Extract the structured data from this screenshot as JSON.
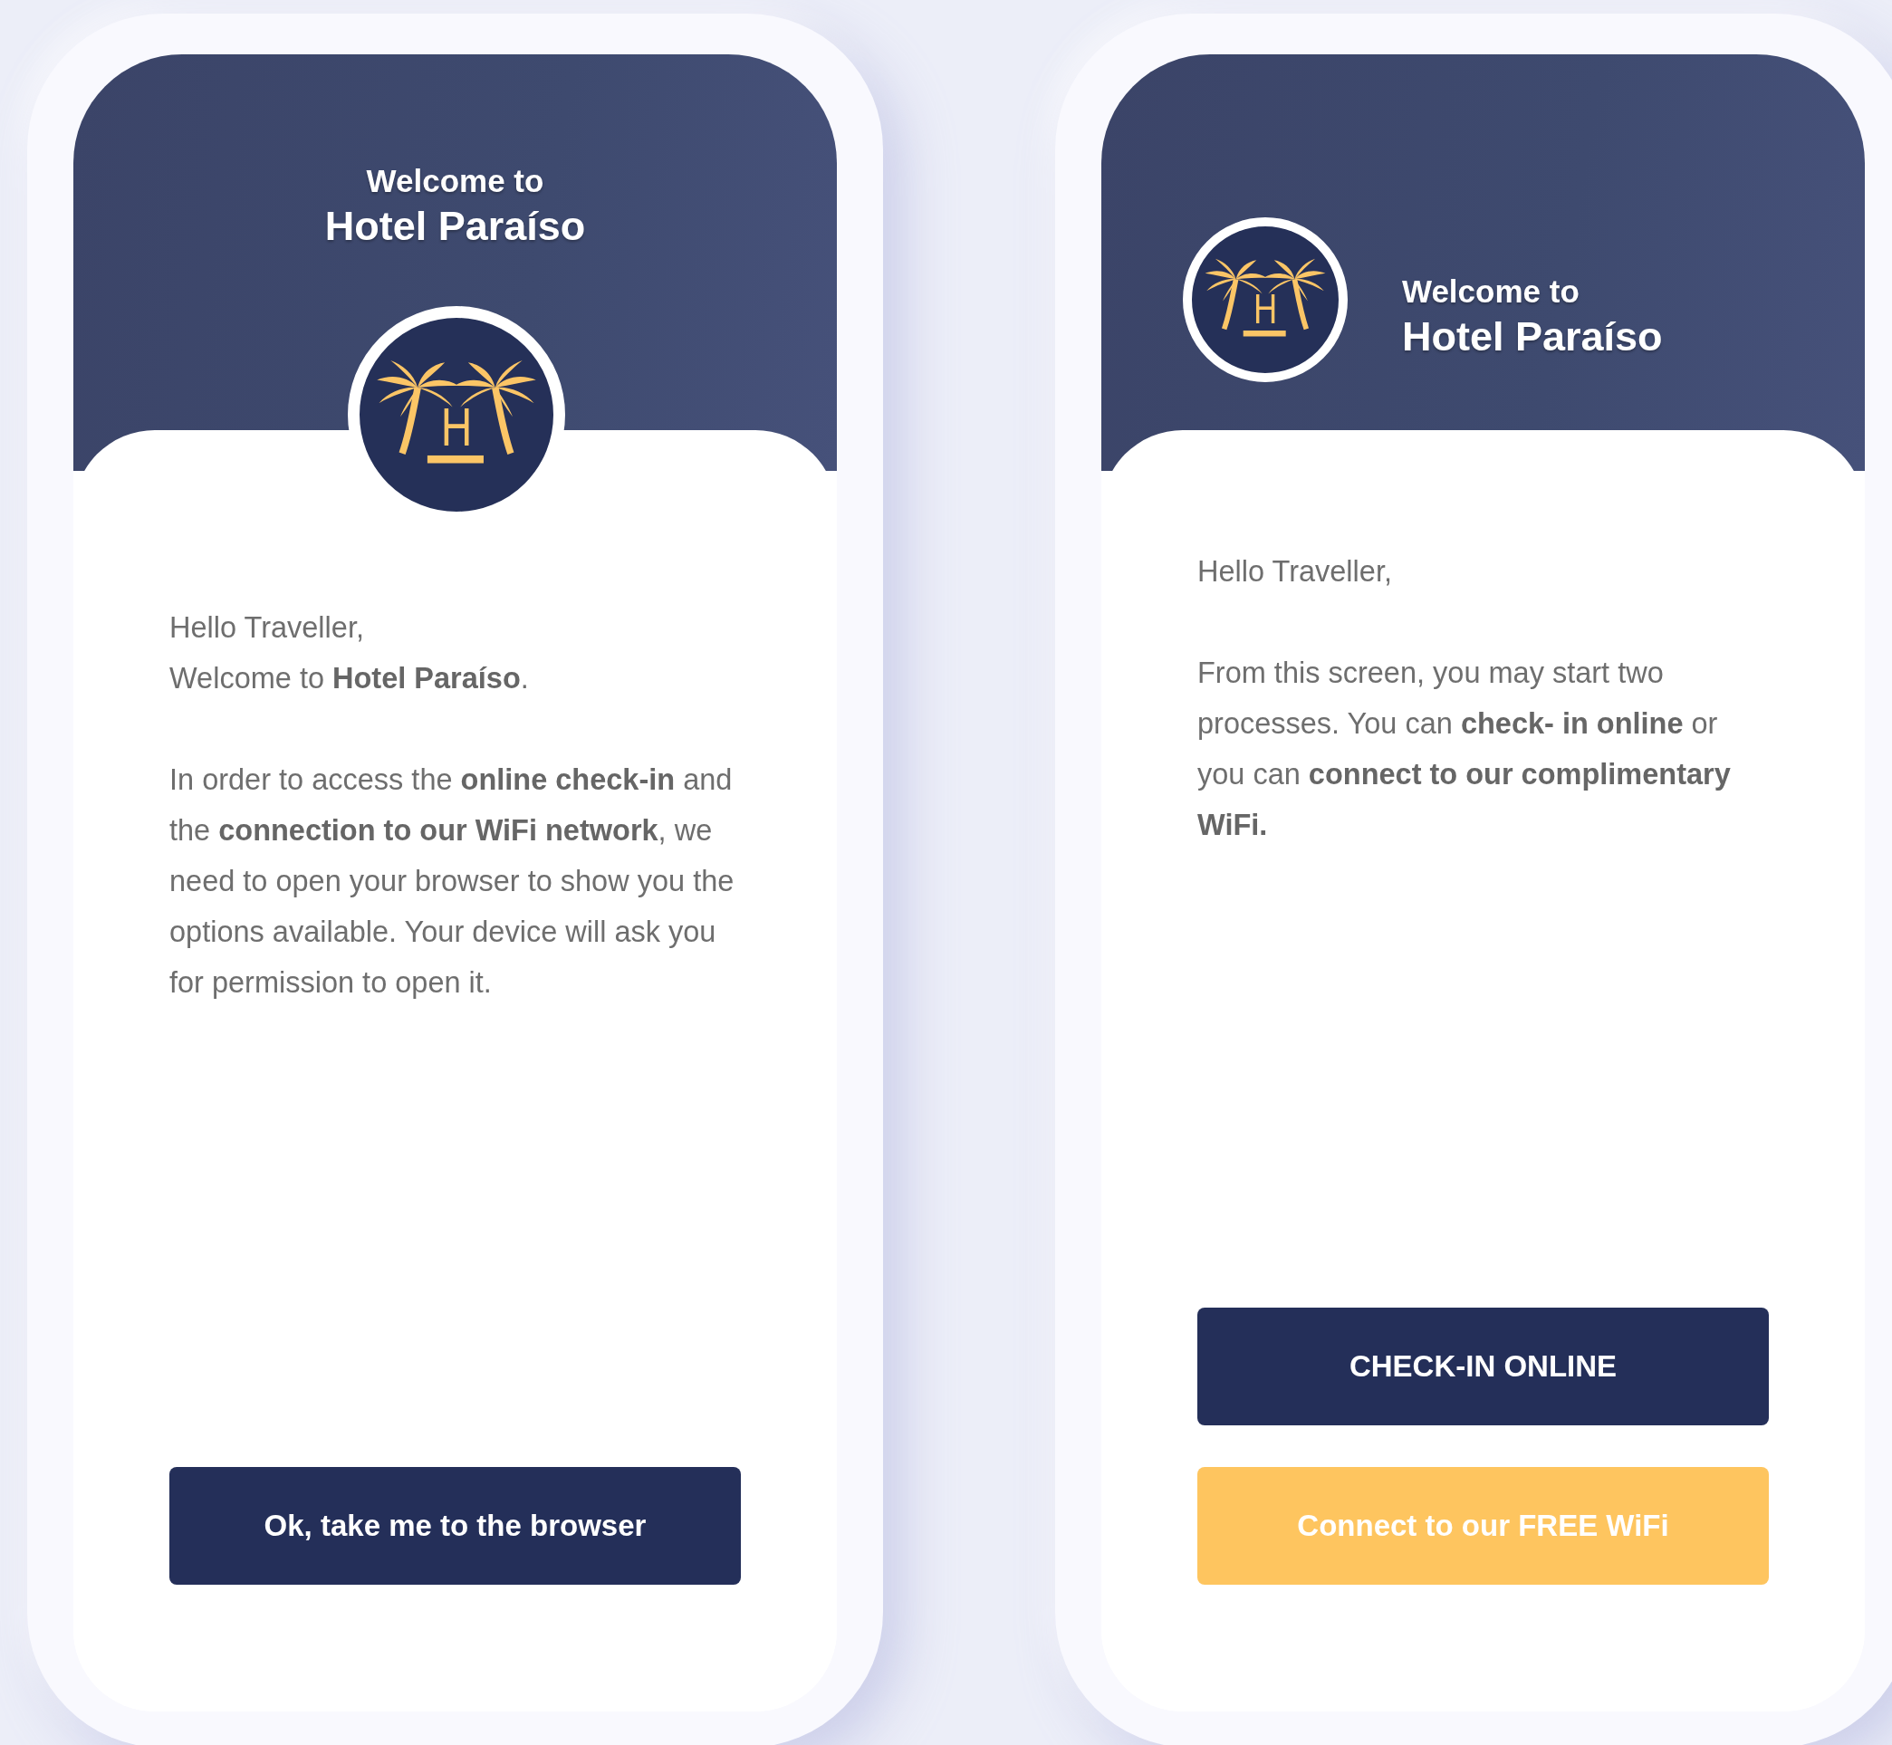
{
  "screens": [
    {
      "kind": "centered",
      "header": {
        "greeting": "Welcome to",
        "hotel_name": "Hotel Paraíso"
      },
      "logo_letter": "H",
      "paragraphs": [
        [
          "Hello Traveller,",
          "Welcome to **Hotel Paraíso**."
        ],
        [
          "In order to access the **online check-in** and the **connection to our WiFi network**, we need to open your browser to show you the options available. Your device will ask you for permission to open it."
        ]
      ],
      "buttons": [
        {
          "label": "Ok, take me to the browser",
          "kind": "primary"
        }
      ]
    },
    {
      "kind": "side",
      "header": {
        "greeting": "Welcome to",
        "hotel_name": "Hotel Paraíso"
      },
      "logo_letter": "H",
      "paragraphs": [
        [
          "Hello Traveller,"
        ],
        [
          "From this screen, you may start two processes. You can **check- in online** or you can **connect to our complimentary WiFi.**"
        ]
      ],
      "buttons": [
        {
          "label": "CHECK-IN ONLINE",
          "kind": "primary"
        },
        {
          "label": "Connect to our FREE WiFi",
          "kind": "accent"
        }
      ]
    }
  ]
}
